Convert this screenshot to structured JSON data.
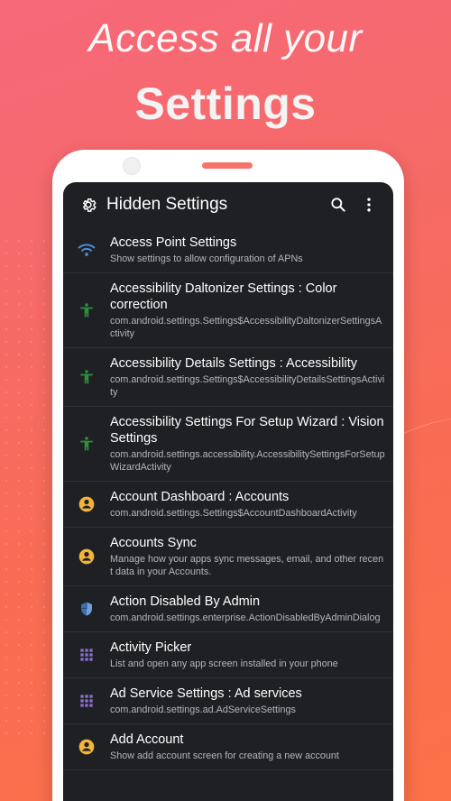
{
  "headline": {
    "line1": "Access all your",
    "line2": "Settings"
  },
  "appbar": {
    "title": "Hidden Settings",
    "app_icon": "gear-icon",
    "actions": [
      "search-icon",
      "more-vert-icon"
    ]
  },
  "colors": {
    "wifi": "#4a8fd8",
    "accessibility": "#2f8f3c",
    "account": "#f2b53a",
    "admin": "#3d6fb5",
    "grid": "#8a6fd0"
  },
  "items": [
    {
      "icon": "wifi-icon",
      "label": "Access Point Settings",
      "sub": "Show settings to allow configuration of APNs"
    },
    {
      "icon": "accessibility-icon",
      "label": "Accessibility Daltonizer Settings : Color correction",
      "sub": "com.android.settings.Settings$AccessibilityDaltonizerSettingsActivity"
    },
    {
      "icon": "accessibility-icon",
      "label": "Accessibility Details Settings : Accessibility",
      "sub": "com.android.settings.Settings$AccessibilityDetailsSettingsActivity"
    },
    {
      "icon": "accessibility-icon",
      "label": "Accessibility Settings For Setup Wizard : Vision Settings",
      "sub": "com.android.settings.accessibility.AccessibilitySettingsForSetupWizardActivity"
    },
    {
      "icon": "account-circle-icon",
      "label": "Account Dashboard : Accounts",
      "sub": "com.android.settings.Settings$AccountDashboardActivity"
    },
    {
      "icon": "account-circle-icon",
      "label": "Accounts Sync",
      "sub": "Manage how your apps sync messages, email, and other recent data in your Accounts."
    },
    {
      "icon": "shield-icon",
      "label": "Action Disabled By Admin",
      "sub": "com.android.settings.enterprise.ActionDisabledByAdminDialog"
    },
    {
      "icon": "grid-icon",
      "label": "Activity Picker",
      "sub": "List and open any app screen installed in your phone"
    },
    {
      "icon": "grid-icon",
      "label": "Ad Service Settings : Ad services",
      "sub": "com.android.settings.ad.AdServiceSettings"
    },
    {
      "icon": "account-circle-icon",
      "label": "Add Account",
      "sub": "Show add account screen for creating a new account"
    }
  ]
}
